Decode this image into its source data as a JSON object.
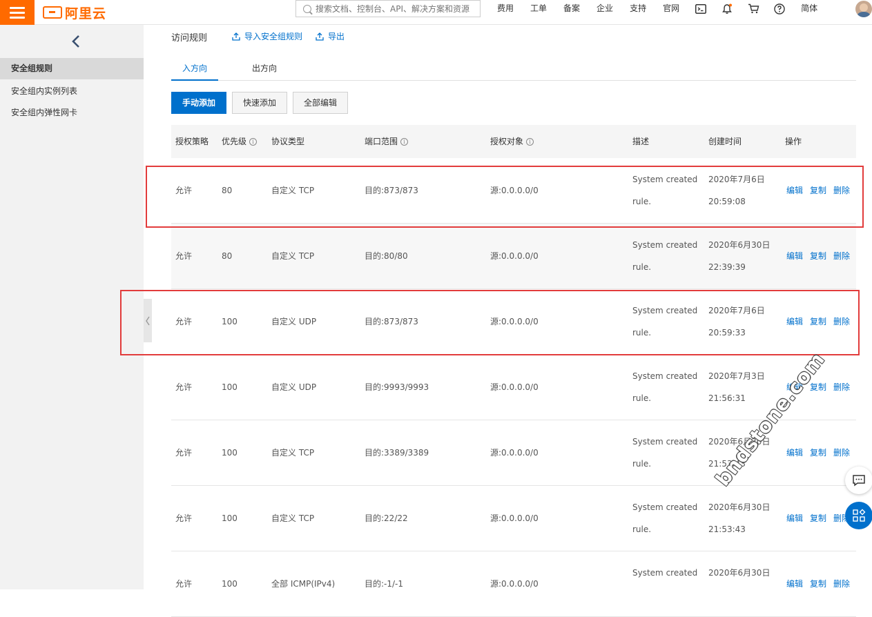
{
  "brand": {
    "logo_text": "阿里云",
    "accent": "#ff6a00"
  },
  "search": {
    "placeholder": "搜索文档、控制台、API、解决方案和资源"
  },
  "nav": {
    "items": [
      "费用",
      "工单",
      "备案",
      "企业",
      "支持",
      "官网"
    ],
    "lang": "简体",
    "icons": [
      "terminal-icon",
      "bell-icon",
      "cart-icon",
      "help-icon"
    ]
  },
  "sidebar": {
    "items": [
      {
        "label": "安全组规则",
        "active": true
      },
      {
        "label": "安全组内实例列表",
        "active": false
      },
      {
        "label": "安全组内弹性网卡",
        "active": false
      }
    ]
  },
  "main": {
    "title": "访问规则",
    "import_label": "导入安全组规则",
    "export_label": "导出",
    "tabs": [
      {
        "label": "入方向",
        "active": true
      },
      {
        "label": "出方向",
        "active": false
      }
    ],
    "buttons": {
      "manual_add": "手动添加",
      "quick_add": "快速添加",
      "edit_all": "全部编辑"
    }
  },
  "table": {
    "headers": {
      "policy": "授权策略",
      "priority": "优先级",
      "protocol": "协议类型",
      "port": "端口范围",
      "target": "授权对象",
      "desc": "描述",
      "created": "创建时间",
      "ops": "操作"
    },
    "ops": {
      "edit": "编辑",
      "copy": "复制",
      "delete": "删除"
    },
    "rows": [
      {
        "policy": "允许",
        "priority": "80",
        "protocol": "自定义 TCP",
        "port": "目的:873/873",
        "target": "源:0.0.0.0/0",
        "desc1": "System created",
        "desc2": "rule.",
        "date": "2020年7月6日",
        "time": "20:59:08"
      },
      {
        "policy": "允许",
        "priority": "80",
        "protocol": "自定义 TCP",
        "port": "目的:80/80",
        "target": "源:0.0.0.0/0",
        "desc1": "System created",
        "desc2": "rule.",
        "date": "2020年6月30日",
        "time": "22:39:39"
      },
      {
        "policy": "允许",
        "priority": "100",
        "protocol": "自定义 UDP",
        "port": "目的:873/873",
        "target": "源:0.0.0.0/0",
        "desc1": "System created",
        "desc2": "rule.",
        "date": "2020年7月6日",
        "time": "20:59:33"
      },
      {
        "policy": "允许",
        "priority": "100",
        "protocol": "自定义 UDP",
        "port": "目的:9993/9993",
        "target": "源:0.0.0.0/0",
        "desc1": "System created",
        "desc2": "rule.",
        "date": "2020年7月3日",
        "time": "21:56:31"
      },
      {
        "policy": "允许",
        "priority": "100",
        "protocol": "自定义 TCP",
        "port": "目的:3389/3389",
        "target": "源:0.0.0.0/0",
        "desc1": "System created",
        "desc2": "rule.",
        "date": "2020年6月30日",
        "time": "21:53:43"
      },
      {
        "policy": "允许",
        "priority": "100",
        "protocol": "自定义 TCP",
        "port": "目的:22/22",
        "target": "源:0.0.0.0/0",
        "desc1": "System created",
        "desc2": "rule.",
        "date": "2020年6月30日",
        "time": "21:53:43"
      },
      {
        "policy": "允许",
        "priority": "100",
        "protocol": "全部 ICMP(IPv4)",
        "port": "目的:-1/-1",
        "target": "源:0.0.0.0/0",
        "desc1": "System created",
        "desc2": "",
        "date": "2020年6月30日",
        "time": ""
      }
    ]
  },
  "watermark": "bndstone.com",
  "colors": {
    "link": "#0070cc",
    "highlight": "#e23b3b"
  }
}
